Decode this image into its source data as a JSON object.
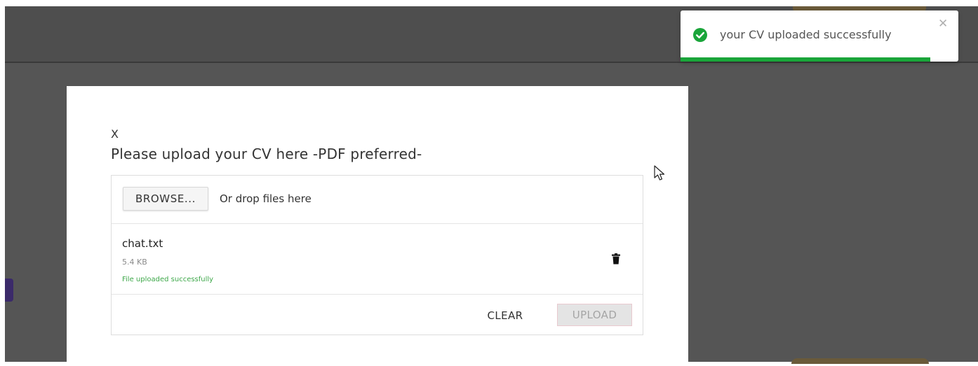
{
  "modal": {
    "close_label": "X",
    "title": "Please upload your CV here -PDF preferred-"
  },
  "uploader": {
    "browse_label": "BROWSE...",
    "drop_hint": "Or drop files here",
    "files": [
      {
        "name": "chat.txt",
        "size": "5.4 KB",
        "status": "File uploaded successfully",
        "delete_icon": "trash-icon"
      }
    ],
    "clear_label": "CLEAR",
    "upload_label": "UPLOAD",
    "upload_disabled": true
  },
  "toast": {
    "message": "your CV uploaded successfully",
    "icon": "check-circle-icon",
    "close_icon": "close-icon",
    "progress": 0.9,
    "accent_color": "#1aa53a"
  },
  "colors": {
    "overlay": "#555555",
    "success_text": "#3ea84a"
  }
}
